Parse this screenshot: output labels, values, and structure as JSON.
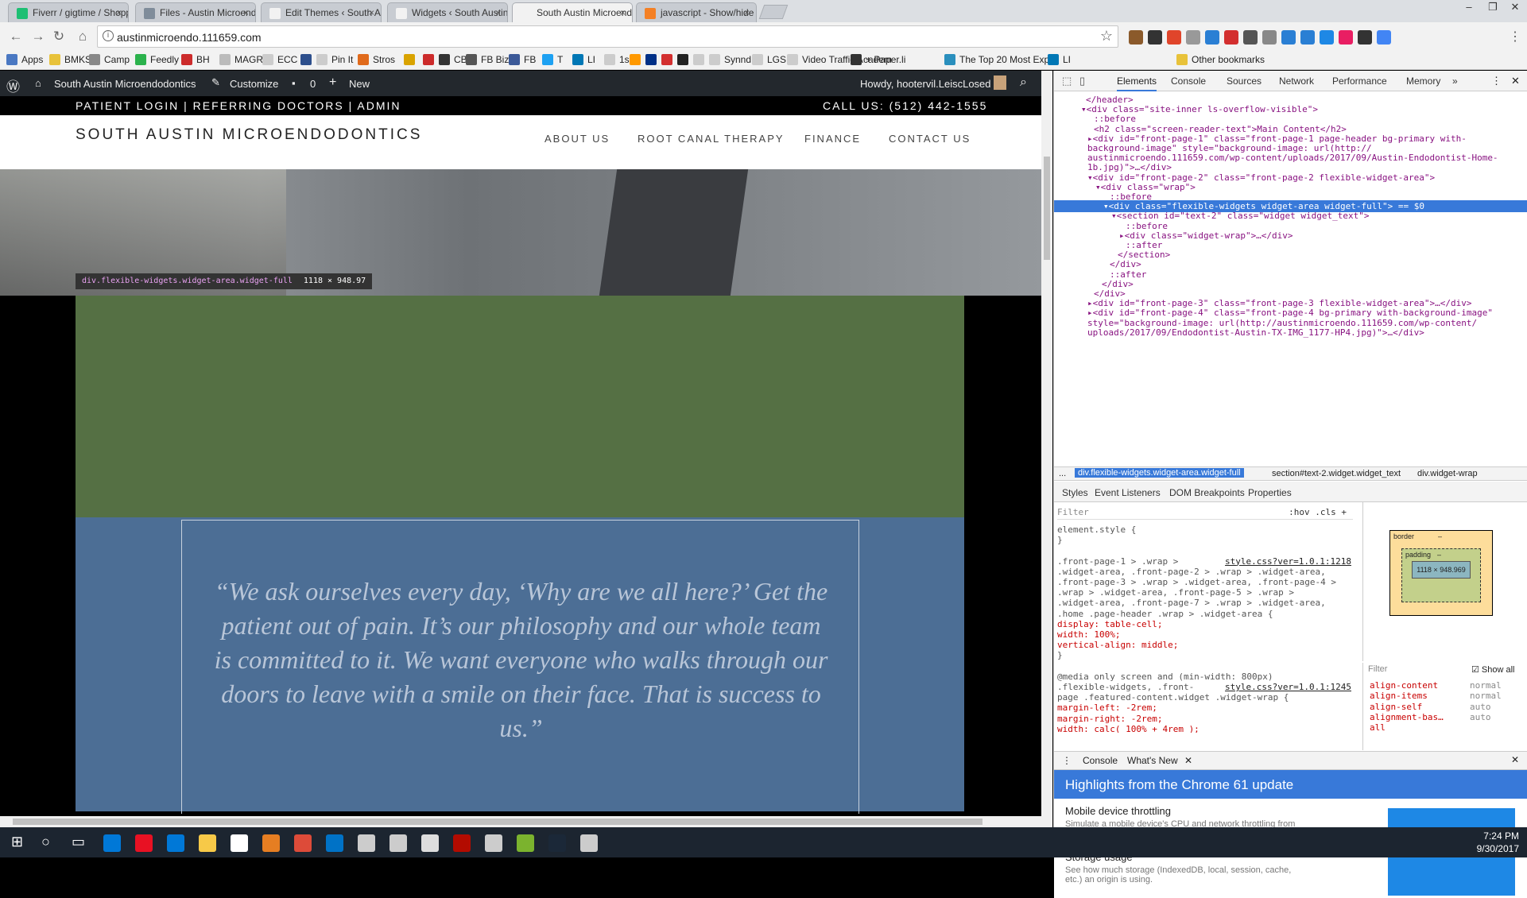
{
  "browser": {
    "tabs": [
      {
        "label": "Fiverr / gigtime / Shoppi",
        "color": "#1dbf73"
      },
      {
        "label": "Files - Austin Microendo",
        "color": "#7f8c9a"
      },
      {
        "label": "Edit Themes ‹ South Aust",
        "color": "#f2f2f2"
      },
      {
        "label": "Widgets ‹ South Austin M",
        "color": "#f2f2f2"
      },
      {
        "label": "South Austin Microendo",
        "color": "#f2f2f2"
      },
      {
        "label": "javascript - Show/hide a",
        "color": "#f48024"
      }
    ],
    "url": "austinmicroendo.111659.com",
    "bookmarks": [
      {
        "label": "Apps",
        "color": "#4a78c2"
      },
      {
        "label": "BMKS",
        "color": "#e8c23a"
      },
      {
        "label": "Camp",
        "color": "#888888"
      },
      {
        "label": "Feedly",
        "color": "#2bb24c"
      },
      {
        "label": "BH",
        "color": "#cc2b2b"
      },
      {
        "label": "MAGR",
        "color": "#bbbbbb"
      },
      {
        "label": "ECC",
        "color": "#cccccc"
      },
      {
        "label": "",
        "color": "#2d4f8c"
      },
      {
        "label": "Pin It",
        "color": "#cccccc"
      },
      {
        "label": "Stros",
        "color": "#e06a1b"
      },
      {
        "label": "",
        "color": "#d9a300"
      },
      {
        "label": "",
        "color": "#cc2b2b"
      },
      {
        "label": "CB",
        "color": "#333333"
      },
      {
        "label": "FB Biz",
        "color": "#555555"
      },
      {
        "label": "FB",
        "color": "#3b5998"
      },
      {
        "label": "T",
        "color": "#1da1f2"
      },
      {
        "label": "LI",
        "color": "#0077b5"
      },
      {
        "label": "1sc",
        "color": "#cccccc"
      },
      {
        "label": "",
        "color": "#f90"
      },
      {
        "label": "",
        "color": "#003087"
      },
      {
        "label": "",
        "color": "#d32f2f"
      },
      {
        "label": "",
        "color": "#222222"
      },
      {
        "label": "",
        "color": "#cccccc"
      },
      {
        "label": "Synnd",
        "color": "#cccccc"
      },
      {
        "label": "LGS",
        "color": "#cccccc"
      },
      {
        "label": "Video Traffic Academ",
        "color": "#cccccc"
      },
      {
        "label": "+ Paper.li",
        "color": "#333333"
      },
      {
        "label": "The Top 20 Most Exp",
        "color": "#2a8fbd"
      },
      {
        "label": "LI",
        "color": "#0077b5"
      },
      {
        "label": "Other bookmarks",
        "color": "#e8c23a"
      }
    ]
  },
  "adminbar": {
    "site_name": "South Austin Microendodontics",
    "customize": "Customize",
    "comments": "0",
    "new": "New",
    "howdy": "Howdy, hootervil.LeiscLosed"
  },
  "site": {
    "topbar_left": "PATIENT LOGIN | REFERRING DOCTORS | ADMIN",
    "topbar_right": "CALL US: (512) 442-1555",
    "title": "SOUTH AUSTIN MICROENDODONTICS",
    "nav": [
      "ABOUT US",
      "ROOT CANAL THERAPY",
      "FINANCE",
      "CONTACT US"
    ],
    "quote": "“We ask ourselves every day, ‘Why are we all here?’ Get the patient out of pain. It’s our philosophy and our whole team is committed to it. We want everyone who walks through our doors to leave with a smile on their face. That is success to us.”",
    "inspect_selector": "div.flexible-widgets.widget-area.widget-full",
    "inspect_size": "1118 × 948.97",
    "colors": {
      "green_band": "#557044",
      "blue_band": "#4c6e95",
      "quote_text": "#b9c6d8"
    }
  },
  "devtools": {
    "tabs": [
      "Elements",
      "Console",
      "Sources",
      "Network",
      "Performance",
      "Memory",
      "»"
    ],
    "dom_lines": [
      {
        "indent": 40,
        "text": "</header>"
      },
      {
        "indent": 34,
        "text": "▾<div class=\"site-inner ls-overflow-visible\">"
      },
      {
        "indent": 50,
        "text": "::before"
      },
      {
        "indent": 50,
        "text": "<h2 class=\"screen-reader-text\">Main Content</h2>"
      },
      {
        "indent": 42,
        "text": "▸<div id=\"front-page-1\" class=\"front-page-1 page-header bg-primary with-"
      },
      {
        "indent": 42,
        "text": "background-image\" style=\"background-image: url(http://"
      },
      {
        "indent": 42,
        "text": "austinmicroendo.111659.com/wp-content/uploads/2017/09/Austin-Endodontist-Home-"
      },
      {
        "indent": 42,
        "text": "1b.jpg)\">…</div>"
      },
      {
        "indent": 42,
        "text": "▾<div id=\"front-page-2\" class=\"front-page-2 flexible-widget-area\">"
      },
      {
        "indent": 52,
        "text": "▾<div class=\"wrap\">"
      },
      {
        "indent": 70,
        "text": "::before"
      },
      {
        "indent": 62,
        "text": "▾<div class=\"flexible-widgets widget-area widget-full\"> == $0"
      },
      {
        "indent": 72,
        "text": "▾<section id=\"text-2\" class=\"widget widget_text\">"
      },
      {
        "indent": 90,
        "text": "::before"
      },
      {
        "indent": 82,
        "text": "▸<div class=\"widget-wrap\">…</div>"
      },
      {
        "indent": 90,
        "text": "::after"
      },
      {
        "indent": 80,
        "text": "</section>"
      },
      {
        "indent": 70,
        "text": "</div>"
      },
      {
        "indent": 70,
        "text": "::after"
      },
      {
        "indent": 60,
        "text": "</div>"
      },
      {
        "indent": 50,
        "text": "</div>"
      },
      {
        "indent": 42,
        "text": "▸<div id=\"front-page-3\" class=\"front-page-3 flexible-widget-area\">…</div>"
      },
      {
        "indent": 42,
        "text": "▸<div id=\"front-page-4\" class=\"front-page-4 bg-primary with-background-image\""
      },
      {
        "indent": 42,
        "text": "style=\"background-image: url(http://austinmicroendo.111659.com/wp-content/"
      },
      {
        "indent": 42,
        "text": "uploads/2017/09/Endodontist-Austin-TX-IMG_1177-HP4.jpg)\">…</div>"
      }
    ],
    "selected_line": 11,
    "breadcrumbs": [
      "...",
      "div.flexible-widgets.widget-area.widget-full",
      "section#text-2.widget.widget_text",
      "div.widget-wrap"
    ],
    "subtabs": [
      "Styles",
      "Event Listeners",
      "DOM Breakpoints",
      "Properties"
    ],
    "filter_placeholder": "Filter",
    "hov_cls": ":hov  .cls  +",
    "style_lines": [
      {
        "text": "element.style {",
        "kind": "sel"
      },
      {
        "text": "}",
        "kind": "sel"
      },
      {
        "text": "",
        "kind": "sel"
      },
      {
        "text": ".front-page-1 > .wrap >",
        "kind": "sel",
        "link": "style.css?ver=1.0.1:1218"
      },
      {
        "text": ".widget-area, .front-page-2 > .wrap > .widget-area,",
        "kind": "sel"
      },
      {
        "text": ".front-page-3 > .wrap > .widget-area, .front-page-4 >",
        "kind": "sel"
      },
      {
        "text": ".wrap > .widget-area, .front-page-5 > .wrap >",
        "kind": "sel"
      },
      {
        "text": ".widget-area, .front-page-7 > .wrap > .widget-area,",
        "kind": "sel"
      },
      {
        "text": ".home .page-header .wrap > .widget-area {",
        "kind": "sel"
      },
      {
        "text": "  display: table-cell;",
        "kind": "prop"
      },
      {
        "text": "  width: 100%;",
        "kind": "prop"
      },
      {
        "text": "  vertical-align: middle;",
        "kind": "prop"
      },
      {
        "text": "}",
        "kind": "sel"
      },
      {
        "text": "",
        "kind": "sel"
      },
      {
        "text": "@media only screen and (min-width: 800px)",
        "kind": "sel"
      },
      {
        "text": ".flexible-widgets, .front-",
        "kind": "sel",
        "link": "style.css?ver=1.0.1:1245"
      },
      {
        "text": "page .featured-content.widget .widget-wrap {",
        "kind": "sel"
      },
      {
        "text": "  margin-left: -2rem;",
        "kind": "prop"
      },
      {
        "text": "  margin-right: -2rem;",
        "kind": "prop"
      },
      {
        "text": "  width: calc( 100% + 4rem );",
        "kind": "prop"
      }
    ],
    "box_model": {
      "border": "border",
      "padding": "padding",
      "content": "1118 × 948.969",
      "dash": "–"
    },
    "computed_filter": "Filter",
    "show_all": "Show all",
    "computed": [
      {
        "name": "align-content",
        "value": "normal"
      },
      {
        "name": "align-items",
        "value": "normal"
      },
      {
        "name": "align-self",
        "value": "auto"
      },
      {
        "name": "alignment-bas…",
        "value": "auto"
      },
      {
        "name": "all",
        "value": ""
      }
    ],
    "drawer_tabs": [
      "Console",
      "What's New"
    ],
    "whats_new_title": "Highlights from the Chrome 61 update",
    "whats_new_items": [
      {
        "title": "Mobile device throttling",
        "desc": "Simulate a mobile device's CPU and network throttling from Device Mode."
      },
      {
        "title": "Storage usage",
        "desc": "See how much storage (IndexedDB, local, session, cache, etc.) an origin is using."
      }
    ]
  },
  "taskbar": {
    "time": "7:24 PM",
    "date": "9/30/2017",
    "apps": [
      "#0078d7",
      "#e81123",
      "#0078d7",
      "#f7c948",
      "#ffffff",
      "#e67e22",
      "#dd4b39",
      "#0072c6",
      "#cccccc",
      "#cccccc",
      "#dddddd",
      "#b30b00",
      "#cccccc",
      "#7bb32e",
      "#1b2838",
      "#cccccc"
    ]
  }
}
